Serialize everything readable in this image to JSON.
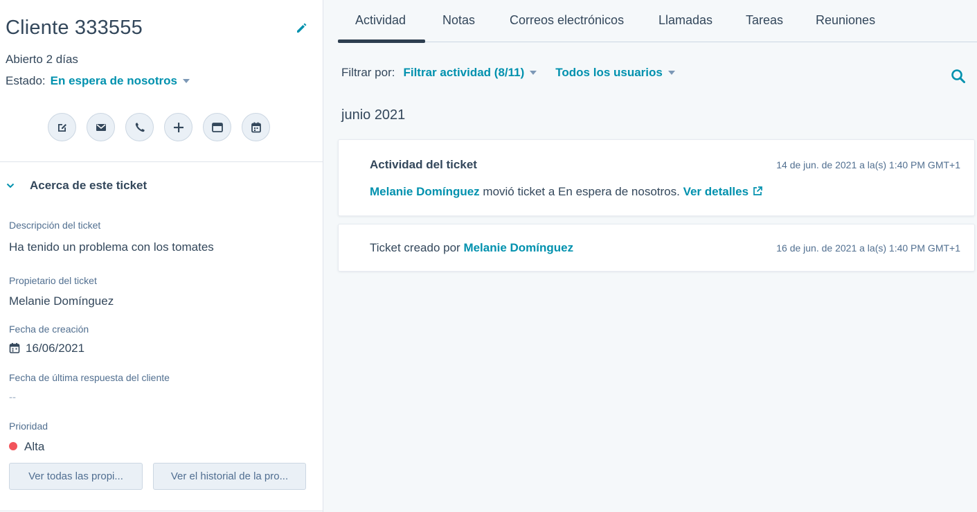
{
  "header": {
    "title": "Cliente 333555",
    "open_text": "Abierto 2 días",
    "status_label": "Estado:",
    "status_value": "En espera de nosotros"
  },
  "actions": [
    {
      "name": "note-button",
      "icon": "pencil-square-icon"
    },
    {
      "name": "email-button",
      "icon": "envelope-icon"
    },
    {
      "name": "call-button",
      "icon": "phone-icon"
    },
    {
      "name": "add-button",
      "icon": "plus-icon"
    },
    {
      "name": "window-button",
      "icon": "window-icon"
    },
    {
      "name": "meeting-button",
      "icon": "calendar-icon"
    }
  ],
  "about": {
    "title": "Acerca de este ticket",
    "description_label": "Descripción del ticket",
    "description_value": "Ha tenido un problema con los tomates",
    "owner_label": "Propietario del ticket",
    "owner_value": "Melanie Domínguez",
    "created_label": "Fecha de creación",
    "created_value": "16/06/2021",
    "last_reply_label": "Fecha de última respuesta del cliente",
    "last_reply_value": "--",
    "priority_label": "Prioridad",
    "priority_value": "Alta",
    "priority_color": "#f2545b",
    "view_all_button": "Ver todas las propi...",
    "view_history_button": "Ver el historial de la pro..."
  },
  "tabs": [
    {
      "label": "Actividad",
      "active": true
    },
    {
      "label": "Notas"
    },
    {
      "label": "Correos electrónicos"
    },
    {
      "label": "Llamadas"
    },
    {
      "label": "Tareas"
    },
    {
      "label": "Reuniones"
    }
  ],
  "filters": {
    "label": "Filtrar por:",
    "activity": "Filtrar actividad (8/11)",
    "users": "Todos los usuarios"
  },
  "timeline": {
    "month": "junio 2021",
    "items": [
      {
        "title": "Actividad del ticket",
        "time": "14 de jun. de 2021 a la(s) 1:40 PM GMT+1",
        "user": "Melanie Domínguez",
        "text": " movió ticket a En espera de nosotros. ",
        "link": "Ver detalles"
      },
      {
        "prefix": "Ticket creado por ",
        "user": "Melanie Domínguez",
        "time": "16 de jun. de 2021 a la(s) 1:40 PM GMT+1"
      }
    ]
  },
  "colors": {
    "accent": "#0091ae",
    "text": "#33475b",
    "background": "#f5f8fa"
  }
}
